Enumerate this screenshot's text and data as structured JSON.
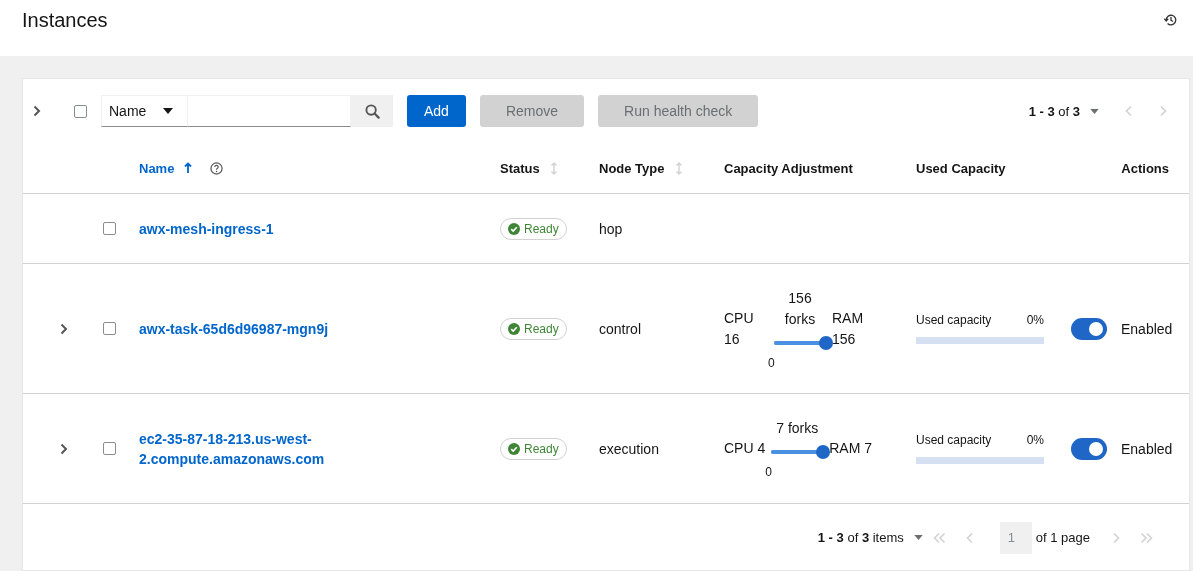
{
  "page": {
    "title": "Instances"
  },
  "toolbar": {
    "select_all": false,
    "filter": "Name",
    "buttons": [
      {
        "label": "Add",
        "disabled": false
      },
      {
        "label": "Remove",
        "disabled": true
      },
      {
        "label": "Run health check",
        "disabled": true
      }
    ],
    "pagination": "**1 - 3** of **3**"
  },
  "columns": [
    {
      "label": "Name",
      "sortable": true,
      "sorted": true,
      "help": true
    },
    {
      "label": "Status",
      "sortable": true,
      "sorted": false,
      "help": false
    },
    {
      "label": "Node Type",
      "sortable": true,
      "sorted": false,
      "help": false
    },
    {
      "label": "Capacity Adjustment",
      "sortable": false,
      "sorted": false,
      "help": false
    },
    {
      "label": "Used Capacity",
      "sortable": false,
      "sorted": false,
      "help": false
    },
    {
      "label": "Actions",
      "sortable": false,
      "sorted": false,
      "help": false
    }
  ],
  "rows": [
    {
      "expandable": false,
      "checked": false,
      "name": "awx-mesh-ingress-1",
      "status": "Ready",
      "node_type": "hop"
    },
    {
      "expandable": true,
      "checked": false,
      "name": "awx-task-65d6d96987-mgn9j",
      "status": "Ready",
      "node_type": "control",
      "capacity": {
        "cpu": "CPU 16",
        "forks": "156 forks",
        "min": "0",
        "ram": "RAM 156",
        "level": 1
      },
      "used": {
        "label": "Used capacity",
        "value": "0%",
        "level": 0
      },
      "enabled": {
        "on": true,
        "label": "Enabled"
      }
    },
    {
      "expandable": true,
      "checked": false,
      "name": "ec2-35-87-18-213.us-west-2.compute.amazonaws.com",
      "status": "Ready",
      "node_type": "execution",
      "capacity": {
        "cpu": "CPU 4",
        "forks": "7 forks",
        "min": "0",
        "ram": "RAM 7",
        "level": 1
      },
      "used": {
        "label": "Used capacity",
        "value": "0%",
        "level": 0
      },
      "enabled": {
        "on": true,
        "label": "Enabled"
      }
    }
  ],
  "footer": {
    "items": "**1 - 3** of **3** items",
    "page": "1",
    "of_pages": "of 1 page"
  }
}
